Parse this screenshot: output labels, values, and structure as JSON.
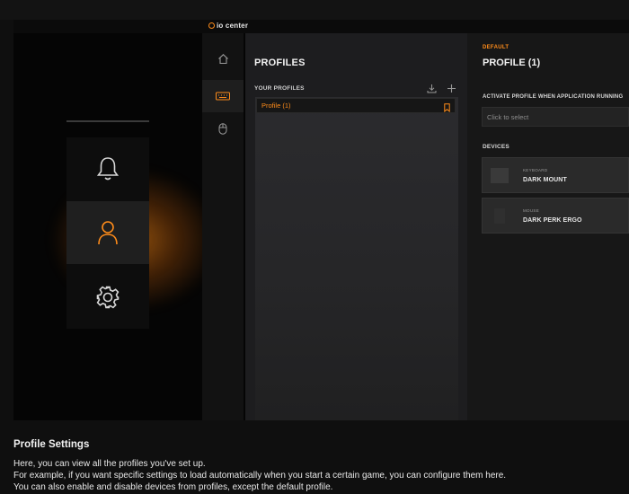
{
  "app": {
    "brand": "io center"
  },
  "rail": {
    "items": [
      {
        "icon": "home-icon"
      },
      {
        "icon": "keyboard-icon",
        "active": true
      },
      {
        "icon": "mouse-icon"
      }
    ]
  },
  "tutorial_nav": {
    "items": [
      {
        "icon": "bell-icon"
      },
      {
        "icon": "user-icon",
        "active": true
      },
      {
        "icon": "gear-icon"
      }
    ]
  },
  "profiles": {
    "title": "PROFILES",
    "subtitle": "YOUR PROFILES",
    "items": [
      {
        "label": "Profile (1)"
      }
    ]
  },
  "details": {
    "tag": "DEFAULT",
    "title": "PROFILE (1)",
    "activate_label": "ACTIVATE PROFILE WHEN APPLICATION RUNNING",
    "select_placeholder": "Click to select",
    "devices_label": "DEVICES",
    "devices": [
      {
        "type": "KEYBOARD",
        "name": "DARK MOUNT"
      },
      {
        "type": "MOUSE",
        "name": "DARK PERK ERGO"
      }
    ]
  },
  "caption": {
    "heading": "Profile Settings",
    "lines": [
      "Here, you can view all the profiles you've set up.",
      "For example, if you want specific settings to load automatically when you start a certain game, you can configure them here.",
      "You can also enable and disable devices from profiles, except the default profile."
    ]
  },
  "colors": {
    "accent": "#ff8c1a",
    "background": "#0b0b0b",
    "panel": "#1d1d1f"
  }
}
